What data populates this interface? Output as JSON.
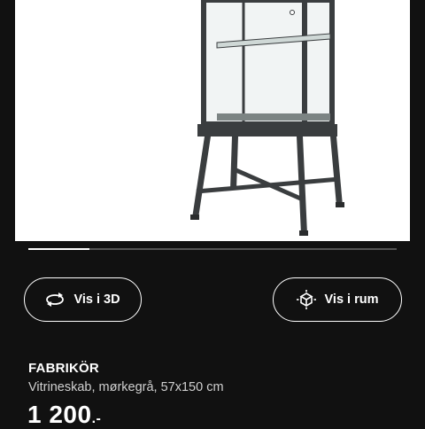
{
  "product_image": {
    "alt": ""
  },
  "carousel": {
    "progress_fraction": 0.165
  },
  "actions": {
    "view_3d": {
      "label": "Vis i 3D",
      "icon": "rotate-3d-icon"
    },
    "view_room": {
      "label": "Vis i rum",
      "icon": "ar-cube-icon"
    }
  },
  "product": {
    "name": "FABRIKÖR",
    "description": "Vitrineskab, mørkegrå, 57x150 cm",
    "price": "1 200",
    "price_suffix": ".-"
  },
  "colors": {
    "background": "#111111",
    "image_background": "#ffffff",
    "cabinet_frame": "#3a3d3f",
    "accent": "#ffffff"
  }
}
